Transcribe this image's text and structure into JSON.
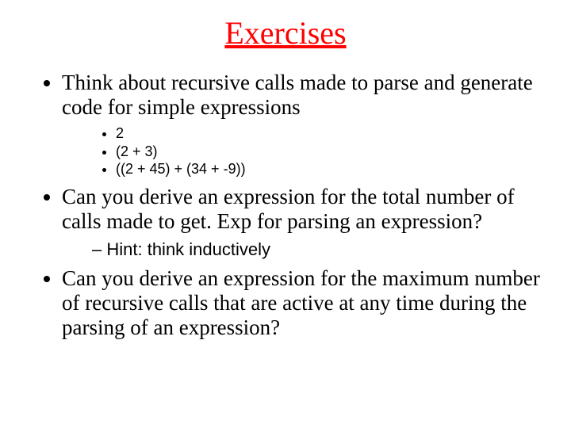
{
  "title": "Exercises",
  "bullets": {
    "b1": "Think about recursive calls made to parse and generate code for simple expressions",
    "b1_sub": {
      "s1": "2",
      "s2": "(2 + 3)",
      "s3": "((2 + 45) + (34 + -9))"
    },
    "b2": "Can you derive an expression for the total number of calls made to get. Exp for parsing an expression?",
    "b2_sub": {
      "s1": "Hint: think inductively"
    },
    "b3": "Can you derive an expression for the maximum number of recursive calls that are active at any time during the parsing of an expression?"
  }
}
